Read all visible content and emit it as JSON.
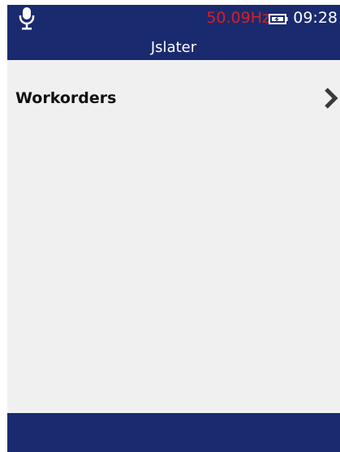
{
  "status_bar": {
    "mic_icon": "microphone-icon",
    "frequency": "50.09Hz",
    "frequency_color": "#d61f26",
    "battery_icon": "battery-charging-icon",
    "time": "09:28"
  },
  "header": {
    "title": "Jslater",
    "background": "#1a2a6e"
  },
  "menu": {
    "items": [
      {
        "label": "Workorders",
        "icon": "chevron-right-icon"
      }
    ]
  },
  "footer": {
    "background": "#1a2a6e"
  }
}
